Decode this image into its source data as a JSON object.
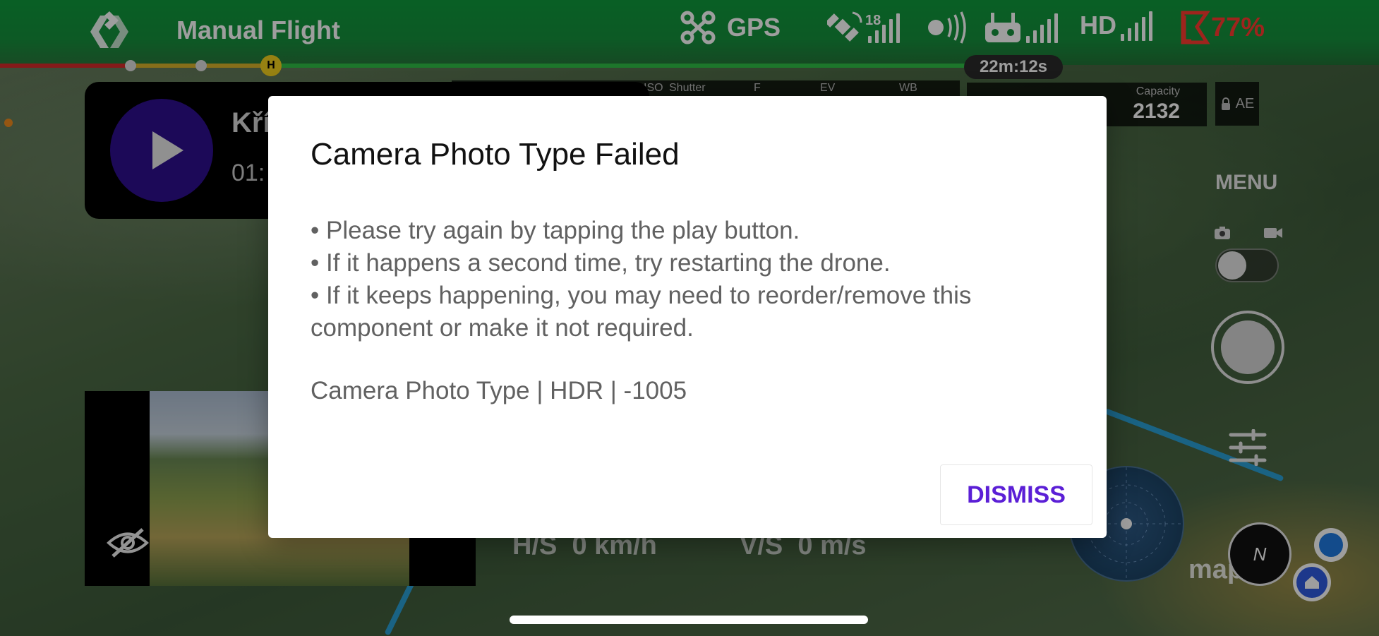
{
  "app": {
    "mode_label": "Manual Flight",
    "logo_icon": "app-logo-icon"
  },
  "status_bar": {
    "gps_label": "GPS",
    "satellite_count": "18",
    "video_label": "HD",
    "battery_percent": "77%",
    "flight_time": "22m:12s",
    "colors": {
      "bar_green": "#15913d",
      "battery_red": "#ff3b30"
    }
  },
  "camera_settings": {
    "labels": [
      "ISO",
      "Shutter",
      "F",
      "EV",
      "WB"
    ],
    "capacity_label": "Capacity",
    "capacity_value": "2132",
    "ae_label": "AE"
  },
  "audio_widget": {
    "title": "Kří",
    "time": "01:",
    "play_icon": "play-icon",
    "accent_color": "#2e0f8f"
  },
  "telemetry": {
    "hs_label": "H/S",
    "hs_value": "0 km/h",
    "vs_label": "V/S",
    "vs_value": "0 m/s"
  },
  "right_panel": {
    "menu_label": "MENU",
    "map_attribution": "map",
    "compass_letter": "N"
  },
  "dialog": {
    "title": "Camera Photo Type Failed",
    "bullets": [
      "• Please try again by tapping the play button.",
      "• If it happens a second time, try restarting the drone.",
      "• If it keeps happening, you may need to reorder/remove this component or make it not required."
    ],
    "error_code": "Camera Photo Type | HDR | -1005",
    "dismiss_label": "DISMISS",
    "accent_color": "#5b1fd6"
  }
}
